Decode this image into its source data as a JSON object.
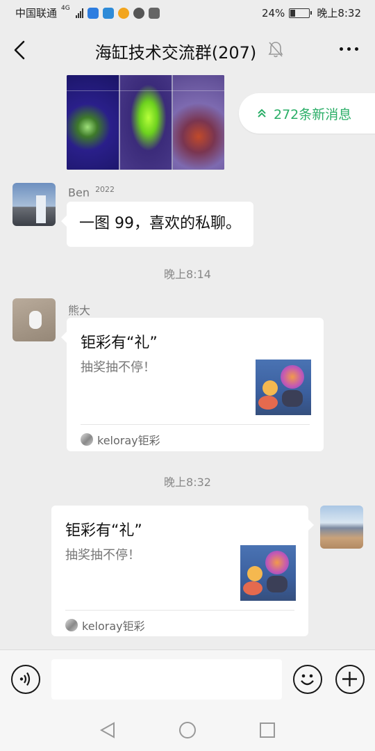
{
  "status_bar": {
    "carrier": "中国联通",
    "network": "4G",
    "battery_percent": "24%",
    "time": "晚上8:32"
  },
  "header": {
    "title": "海缸技术交流群(207)",
    "back_icon": "chevron-left-icon",
    "mute_icon": "bell-muted-icon",
    "more_icon": "more-dots-icon"
  },
  "new_messages": {
    "label": "272条新消息",
    "icon": "double-chevron-up-icon"
  },
  "messages": [
    {
      "type": "image",
      "sender": ""
    },
    {
      "type": "text",
      "sender": "Ben",
      "sender_suffix": "2022",
      "text": "一图 99，喜欢的私聊。"
    },
    {
      "type": "time",
      "text": "晚上8:14"
    },
    {
      "type": "link_card",
      "sender": "熊大",
      "title": "钜彩有“礼”",
      "desc": "抽奖抽不停！",
      "source": "keloray钜彩"
    },
    {
      "type": "time",
      "text": "晚上8:32"
    },
    {
      "type": "link_card",
      "sender": "self",
      "title": "钜彩有“礼”",
      "desc": "抽奖抽不停！",
      "source": "keloray钜彩"
    }
  ],
  "input_bar": {
    "voice_icon": "voice-icon",
    "emoji_icon": "emoji-icon",
    "plus_icon": "plus-icon",
    "placeholder": ""
  },
  "nav_bar": {
    "back": "nav-back-icon",
    "home": "nav-home-icon",
    "recents": "nav-recents-icon"
  },
  "colors": {
    "background": "#ededed",
    "bubble": "#ffffff",
    "accent_green": "#2aae67"
  }
}
